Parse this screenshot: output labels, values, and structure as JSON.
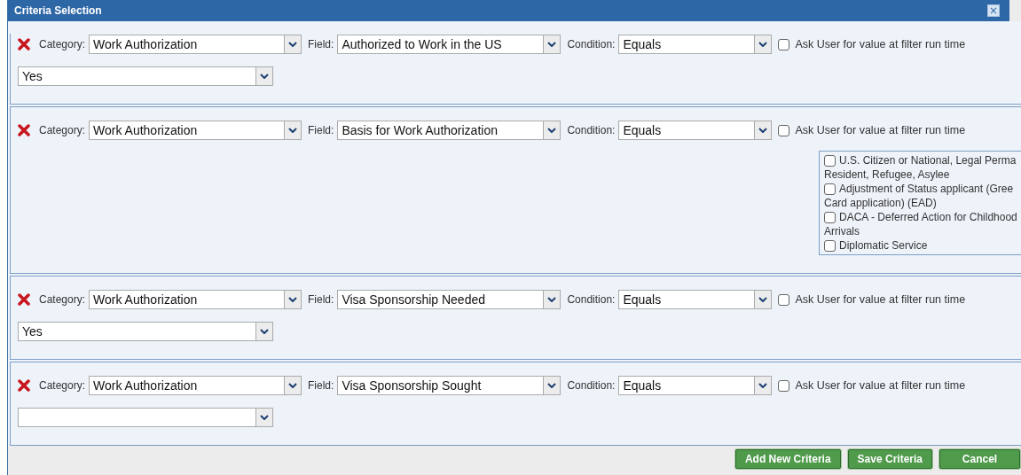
{
  "window": {
    "title": "Criteria Selection",
    "close": "×"
  },
  "criteria": [
    {
      "category_label": "Category:",
      "category": "Work Authorization",
      "field_label": "Field:",
      "field": "Authorized to Work in the US",
      "condition_label": "Condition:",
      "condition": "Equals",
      "ask_user": {
        "label": "Ask User for value at filter run time",
        "checked": false
      },
      "value": {
        "kind": "select",
        "text": "Yes"
      }
    },
    {
      "category_label": "Category:",
      "category": "Work Authorization",
      "field_label": "Field:",
      "field": "Basis for Work Authorization",
      "condition_label": "Condition:",
      "condition": "Equals",
      "ask_user": {
        "label": "Ask User for value at filter run time",
        "checked": false
      },
      "value": {
        "kind": "checklist",
        "options": [
          {
            "label": "U.S. Citizen or National, Legal Perma",
            "cont": "Resident, Refugee, Asylee",
            "checked": false
          },
          {
            "label": "Adjustment of Status applicant (Gree",
            "cont": "Card application) (EAD)",
            "checked": false
          },
          {
            "label": "DACA - Deferred Action for Childhood",
            "cont": "Arrivals",
            "checked": false
          },
          {
            "label": "Diplomatic Service",
            "checked": false
          }
        ]
      }
    },
    {
      "category_label": "Category:",
      "category": "Work Authorization",
      "field_label": "Field:",
      "field": "Visa Sponsorship Needed",
      "condition_label": "Condition:",
      "condition": "Equals",
      "ask_user": {
        "label": "Ask User for value at filter run time",
        "checked": false
      },
      "value": {
        "kind": "select",
        "text": "Yes"
      }
    },
    {
      "category_label": "Category:",
      "category": "Work Authorization",
      "field_label": "Field:",
      "field": "Visa Sponsorship Sought",
      "condition_label": "Condition:",
      "condition": "Equals",
      "ask_user": {
        "label": "Ask User for value at filter run time",
        "checked": false
      },
      "value": {
        "kind": "select"
      }
    }
  ],
  "buttons": [
    "Add New Criteria",
    "Save Criteria",
    "Cancel"
  ]
}
